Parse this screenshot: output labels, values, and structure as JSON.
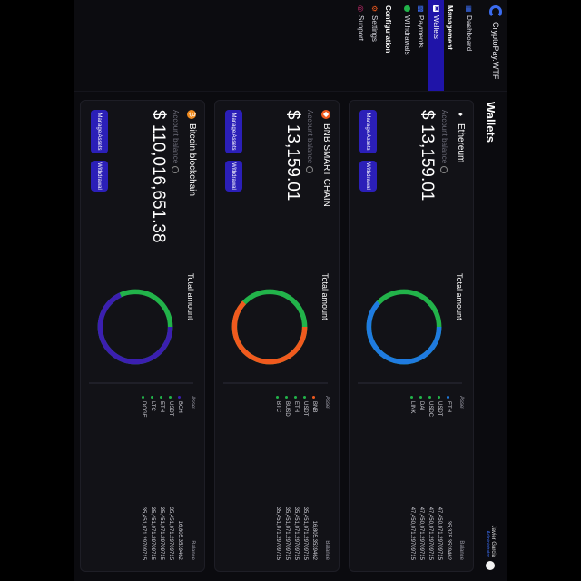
{
  "app": {
    "name": "CryptoPay.WTF"
  },
  "sidebar": {
    "dashboard": "Dashboard",
    "management_section": "Management",
    "wallets": "Wallets",
    "payments": "Payments",
    "withdrawals": "Withdrawals",
    "configuration_section": "Configuration",
    "settings": "Settings",
    "support": "Support"
  },
  "header": {
    "title": "Wallets",
    "user_name": "Javier Garcia",
    "user_role": "Administrator"
  },
  "labels": {
    "account_balance": "Account balance",
    "total_amount": "Total amount",
    "asset": "Asset",
    "balance": "Balance",
    "manage_assets": "Manage Assets",
    "withdrawal": "Withdrawal"
  },
  "colors": {
    "accent": "#2b1fb8",
    "green": "#22b34a",
    "blue": "#1f7be0",
    "orange": "#f05a1e",
    "purple": "#3b1fb0"
  },
  "wallets": [
    {
      "name": "Ethereum",
      "icon": "ethereum-icon",
      "balance": "$ 13,159.01",
      "assets": [
        {
          "asset": "ETH",
          "balance": "35,375.3539462",
          "color": "#1f7be0"
        },
        {
          "asset": "USDT",
          "balance": "47,450,071.29709715",
          "color": "#22b34a"
        },
        {
          "asset": "USDC",
          "balance": "47,450,071.29709715",
          "color": "#22b34a"
        },
        {
          "asset": "DAI",
          "balance": "47,450,071.29709715",
          "color": "#22b34a"
        },
        {
          "asset": "LINK",
          "balance": "47,450,071.29709715",
          "color": "#22b34a"
        }
      ],
      "chart": {
        "primary_color": "#1f7be0",
        "secondary_color": "#22b34a",
        "primary_fraction": 0.62
      }
    },
    {
      "name": "BNB SMART CHAIN",
      "icon": "bnb-icon",
      "balance": "$ 13,159.01",
      "assets": [
        {
          "asset": "BNB",
          "balance": "16,805.3539462",
          "color": "#f05a1e"
        },
        {
          "asset": "USDT",
          "balance": "35,451,071.29709715",
          "color": "#22b34a"
        },
        {
          "asset": "ETH",
          "balance": "35,451,071.29709715",
          "color": "#22b34a"
        },
        {
          "asset": "BUSD",
          "balance": "35,451,071.29709715",
          "color": "#22b34a"
        },
        {
          "asset": "BTC",
          "balance": "35,451,071.29709715",
          "color": "#22b34a"
        }
      ],
      "chart": {
        "primary_color": "#f05a1e",
        "secondary_color": "#22b34a",
        "primary_fraction": 0.62
      }
    },
    {
      "name": "Bitcoin blockchain",
      "icon": "bitcoin-icon",
      "balance": "$ 110,016,651.38",
      "assets": [
        {
          "asset": "BCH",
          "balance": "16,805.3539462",
          "color": "#3b1fb0"
        },
        {
          "asset": "USDT",
          "balance": "35,451,071.29709715",
          "color": "#22b34a"
        },
        {
          "asset": "ETH",
          "balance": "35,451,071.29709715",
          "color": "#22b34a"
        },
        {
          "asset": "LTC",
          "balance": "35,451,071.29709715",
          "color": "#22b34a"
        },
        {
          "asset": "DOGE",
          "balance": "35,451,071.29709715",
          "color": "#22b34a"
        }
      ],
      "chart": {
        "primary_color": "#3b1fb0",
        "secondary_color": "#22b34a",
        "primary_fraction": 0.68
      }
    }
  ]
}
